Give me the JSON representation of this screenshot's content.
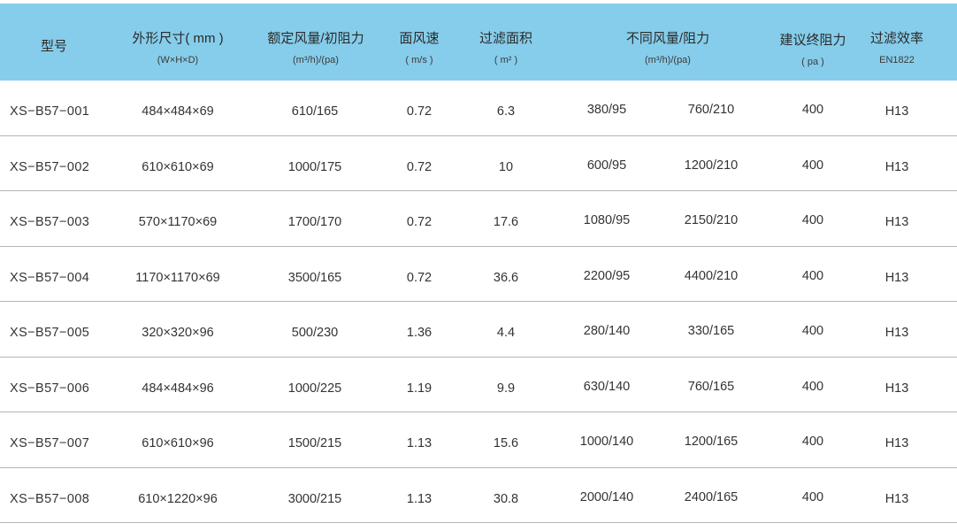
{
  "header": {
    "model": "型号",
    "size": "外形尺寸( mm )",
    "size_sub": "(W×H×D)",
    "rated": "额定风量/初阻力",
    "rated_sub": "(m³/h)/(pa)",
    "velocity": "面风速",
    "velocity_sub": "( m/s )",
    "area": "过滤面积",
    "area_sub": "( m² )",
    "varflow": "不同风量/阻力",
    "varflow_sub": "(m³/h)/(pa)",
    "final": "建议终阻力",
    "final_sub": "( pa )",
    "efficiency": "过滤效率",
    "efficiency_sub": "EN1822"
  },
  "rows": [
    {
      "model": "XS−B57−001",
      "size": "484×484×69",
      "rated": "610/165",
      "velocity": "0.72",
      "area": "6.3",
      "flow1": "380/95",
      "flow2": "760/210",
      "final": "400",
      "eff": "H13"
    },
    {
      "model": "XS−B57−002",
      "size": "610×610×69",
      "rated": "1000/175",
      "velocity": "0.72",
      "area": "10",
      "flow1": "600/95",
      "flow2": "1200/210",
      "final": "400",
      "eff": "H13"
    },
    {
      "model": "XS−B57−003",
      "size": "570×1170×69",
      "rated": "1700/170",
      "velocity": "0.72",
      "area": "17.6",
      "flow1": "1080/95",
      "flow2": "2150/210",
      "final": "400",
      "eff": "H13"
    },
    {
      "model": "XS−B57−004",
      "size": "1170×1170×69",
      "rated": "3500/165",
      "velocity": "0.72",
      "area": "36.6",
      "flow1": "2200/95",
      "flow2": "4400/210",
      "final": "400",
      "eff": "H13"
    },
    {
      "model": "XS−B57−005",
      "size": "320×320×96",
      "rated": "500/230",
      "velocity": "1.36",
      "area": "4.4",
      "flow1": "280/140",
      "flow2": "330/165",
      "final": "400",
      "eff": "H13"
    },
    {
      "model": "XS−B57−006",
      "size": "484×484×96",
      "rated": "1000/225",
      "velocity": "1.19",
      "area": "9.9",
      "flow1": "630/140",
      "flow2": "760/165",
      "final": "400",
      "eff": "H13"
    },
    {
      "model": "XS−B57−007",
      "size": "610×610×96",
      "rated": "1500/215",
      "velocity": "1.13",
      "area": "15.6",
      "flow1": "1000/140",
      "flow2": "1200/165",
      "final": "400",
      "eff": "H13"
    },
    {
      "model": "XS−B57−008",
      "size": "610×1220×96",
      "rated": "3000/215",
      "velocity": "1.13",
      "area": "30.8",
      "flow1": "2000/140",
      "flow2": "2400/165",
      "final": "400",
      "eff": "H13"
    }
  ],
  "colors": {
    "header_bg": "#86cdeb",
    "row_border": "#b5b5b5",
    "text": "#333333"
  }
}
